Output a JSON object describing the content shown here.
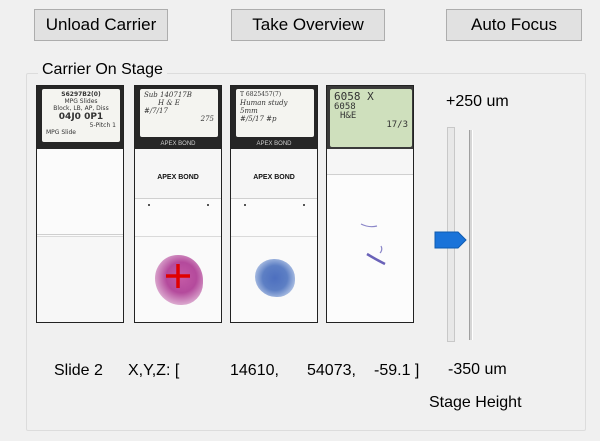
{
  "toolbar": {
    "unload_label": "Unload Carrier",
    "overview_label": "Take Overview",
    "autofocus_label": "Auto Focus"
  },
  "group_title": "Carrier On Stage",
  "slides": [
    {
      "label_lines": [
        "S6297B2(0)",
        "MPG Slides",
        "Block, LB, AP, Diss",
        "04J0 0P1",
        "5-Pitch 1",
        "MPG Slide"
      ]
    },
    {
      "label_lines": [
        "Sub 140717B",
        "H & E",
        "#/7/17",
        "275"
      ],
      "dark_band": "APEX BOND",
      "frost": "APEX BOND"
    },
    {
      "label_lines": [
        "T 6825457(7)",
        "Human study",
        "5mm",
        "#/5/17 #p"
      ],
      "dark_band": "APEX BOND",
      "frost": "APEX BOND"
    },
    {
      "label_lines": [
        "6058 X",
        "6058",
        "H&E",
        "17/3"
      ]
    }
  ],
  "stage_height": {
    "max_label": "+250 um",
    "min_label": "-350 um",
    "caption": "Stage Height",
    "max": 250,
    "min": -350,
    "current": -59.1
  },
  "status": {
    "slide": "Slide 2",
    "coords_label": "X,Y,Z: [",
    "x": "14610,",
    "y": "54073,",
    "z": "-59.1 ]"
  },
  "colors": {
    "thumb": "#1a73d9",
    "cross": "#e00000",
    "he_stain": "#b44a9c",
    "blue_stain": "#5d7fc4",
    "label_dark": "#262626",
    "label_green": "#cfe0bd"
  }
}
